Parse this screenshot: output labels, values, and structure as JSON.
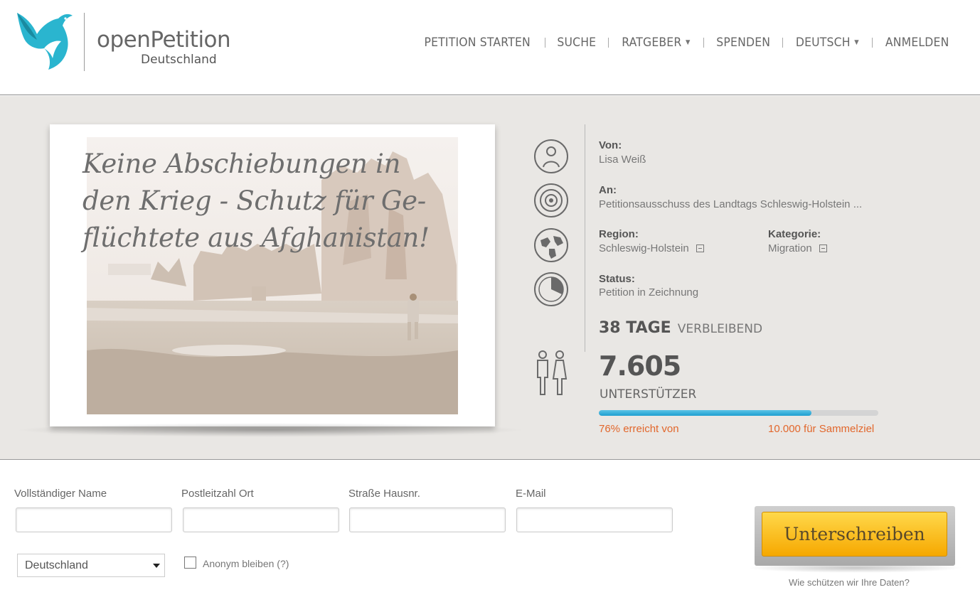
{
  "brand": {
    "name": "openPetition",
    "country": "Deutschland",
    "color": "#2ab5cf"
  },
  "nav": {
    "items": [
      {
        "label": "PETITION STARTEN",
        "caret": false
      },
      {
        "label": "SUCHE",
        "caret": false
      },
      {
        "label": "RATGEBER",
        "caret": true
      },
      {
        "label": "SPENDEN",
        "caret": false
      },
      {
        "label": "DEUTSCH",
        "caret": true
      },
      {
        "label": "ANMELDEN",
        "caret": false
      }
    ]
  },
  "petition": {
    "title": "Keine Abschiebungen in den Krieg - Schutz für Ge-flüchtete aus Afghanistan!",
    "title_lines": [
      "Keine Abschiebungen in",
      "den Krieg - Schutz für Ge-",
      "flüchtete aus Afghanistan!"
    ],
    "from_label": "Von:",
    "from_value": "Lisa Weiß",
    "to_label": "An:",
    "to_value": "Petitionsausschuss des Landtags Schleswig-Holstein ...",
    "region_label": "Region:",
    "region_value": "Schleswig-Holstein",
    "category_label": "Kategorie:",
    "category_value": "Migration",
    "status_label": "Status:",
    "status_value": "Petition in Zeichnung",
    "days_value": "38 TAGE",
    "days_label": "VERBLEIBEND",
    "supporters_value": "7.605",
    "supporters_label": "UNTERSTÜTZER",
    "progress_percent": 76,
    "progress_text": "76% erreicht von",
    "goal_text": "10.000  für Sammelziel",
    "accent_color": "#e2672c"
  },
  "form": {
    "name_label": "Vollständiger Name",
    "zip_label": "Postleitzahl Ort",
    "street_label": "Straße Hausnr.",
    "email_label": "E-Mail",
    "name_value": "",
    "zip_value": "",
    "street_value": "",
    "email_value": "",
    "country_selected": "Deutschland",
    "anonymous_label": "Anonym bleiben (?)",
    "sign_label": "Unterschreiben",
    "privacy_link": "Wie schützen wir Ihre Daten?"
  }
}
